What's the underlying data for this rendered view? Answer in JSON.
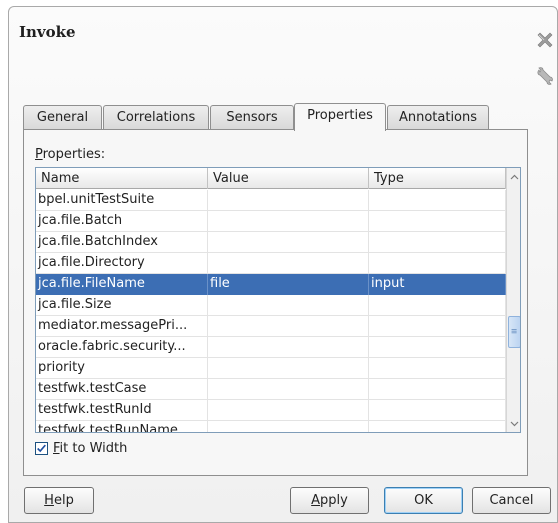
{
  "dialog": {
    "title": "Invoke",
    "tabs": [
      {
        "label": "General",
        "active": false
      },
      {
        "label": "Correlations",
        "active": false
      },
      {
        "label": "Sensors",
        "active": false
      },
      {
        "label": "Properties",
        "active": true
      },
      {
        "label": "Annotations",
        "active": false
      }
    ]
  },
  "properties": {
    "label_mnemonic": "P",
    "label_rest": "roperties:",
    "columns": [
      "Name",
      "Value",
      "Type"
    ],
    "rows": [
      {
        "name": "bpel.unitTestSuite",
        "value": "",
        "type": ""
      },
      {
        "name": "jca.file.Batch",
        "value": "",
        "type": ""
      },
      {
        "name": "jca.file.BatchIndex",
        "value": "",
        "type": ""
      },
      {
        "name": "jca.file.Directory",
        "value": "",
        "type": ""
      },
      {
        "name": "jca.file.FileName",
        "value": "file",
        "type": "input",
        "selected": true
      },
      {
        "name": "jca.file.Size",
        "value": "",
        "type": ""
      },
      {
        "name": "mediator.messagePri...",
        "value": "",
        "type": ""
      },
      {
        "name": "oracle.fabric.security...",
        "value": "",
        "type": ""
      },
      {
        "name": "priority",
        "value": "",
        "type": ""
      },
      {
        "name": "testfwk.testCase",
        "value": "",
        "type": ""
      },
      {
        "name": "testfwk.testRunId",
        "value": "",
        "type": ""
      },
      {
        "name": "testfwk.testRunName",
        "value": "",
        "type": ""
      }
    ],
    "fit_to_width": {
      "mnemonic": "F",
      "rest": "it to Width",
      "checked": true
    }
  },
  "buttons": {
    "help": {
      "mnemonic": "H",
      "rest": "elp"
    },
    "apply": {
      "mnemonic": "A",
      "rest": "pply"
    },
    "ok": "OK",
    "cancel": "Cancel"
  },
  "colors": {
    "selection": "#3c6eb4",
    "accent": "#1c5180"
  },
  "icons": {
    "close": "close-icon",
    "settings": "wrench-icon",
    "check": "checkmark-icon"
  }
}
